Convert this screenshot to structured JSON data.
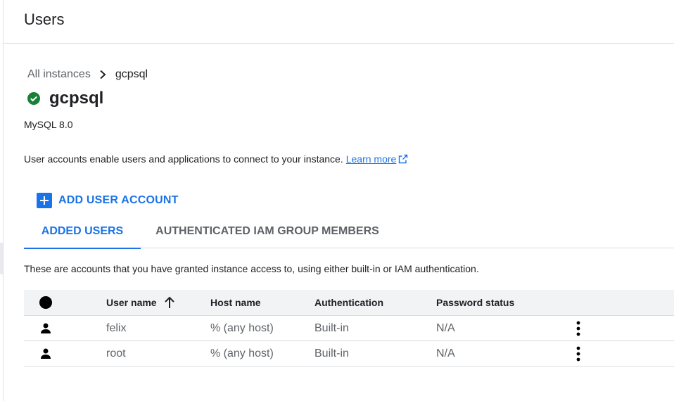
{
  "header": {
    "title": "Users"
  },
  "breadcrumb": {
    "parent": "All instances",
    "current": "gcpsql"
  },
  "instance": {
    "name": "gcpsql",
    "version": "MySQL 8.0",
    "status_icon": "check-circle-icon",
    "status_color": "#188038"
  },
  "info": {
    "text": "User accounts enable users and applications to connect to your instance.",
    "learn_more": "Learn more",
    "learn_more_icon": "external-link-icon"
  },
  "actions": {
    "add_user_label": "ADD USER ACCOUNT",
    "add_icon": "plus-box-icon"
  },
  "tabs": [
    {
      "label": "ADDED USERS",
      "active": true
    },
    {
      "label": "AUTHENTICATED IAM GROUP MEMBERS",
      "active": false
    }
  ],
  "description": "These are accounts that you have granted instance access to, using either built-in or IAM authentication.",
  "table": {
    "columns": {
      "user": "User name",
      "host": "Host name",
      "auth": "Authentication",
      "password": "Password status"
    },
    "sort": {
      "column": "user",
      "direction": "ascending",
      "icon": "arrow-up-icon"
    },
    "rows": [
      {
        "user": "felix",
        "host": "% (any host)",
        "auth": "Built-in",
        "password": "N/A"
      },
      {
        "user": "root",
        "host": "% (any host)",
        "auth": "Built-in",
        "password": "N/A"
      }
    ]
  },
  "colors": {
    "accent": "#1a73e8",
    "success": "#188038",
    "text": "#202124",
    "muted": "#5f6368"
  }
}
